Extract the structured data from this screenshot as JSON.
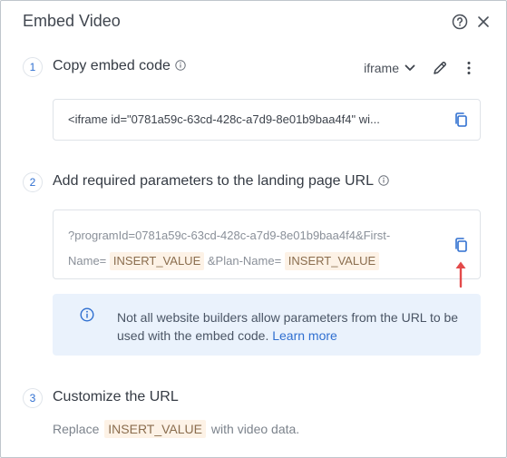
{
  "dialog": {
    "title": "Embed Video"
  },
  "step1": {
    "number": "1",
    "title": "Copy embed code",
    "format_selected": "iframe",
    "code": "<iframe id=\"0781a59c-63cd-428c-a7d9-8e01b9baa4f4\" wi..."
  },
  "step2": {
    "number": "2",
    "title": "Add required parameters to the landing page URL",
    "url_line1": "?programId=0781a59c-63cd-428c-a7d9-8e01b9baa4f4&First-",
    "url_prefix2": "Name=",
    "token1": "INSERT_VALUE",
    "url_mid": "&Plan-Name=",
    "token2": "INSERT_VALUE",
    "notice_text": "Not all website builders allow parameters from the URL to be used with the embed code.",
    "notice_link": "Learn more"
  },
  "step3": {
    "number": "3",
    "title": "Customize the URL",
    "replace_prefix": "Replace",
    "token": "INSERT_VALUE",
    "replace_suffix": "with video data."
  },
  "colors": {
    "accent": "#2f6fd0",
    "token_bg": "#fdf2e6",
    "notice_bg": "#eaf2fc",
    "arrow": "#e34a4a"
  },
  "icons": [
    "help-icon",
    "close-icon",
    "info-icon",
    "chevron-down-icon",
    "edit-pencil-icon",
    "more-vertical-icon",
    "copy-icon",
    "info-circle-icon",
    "arrow-up-icon"
  ]
}
